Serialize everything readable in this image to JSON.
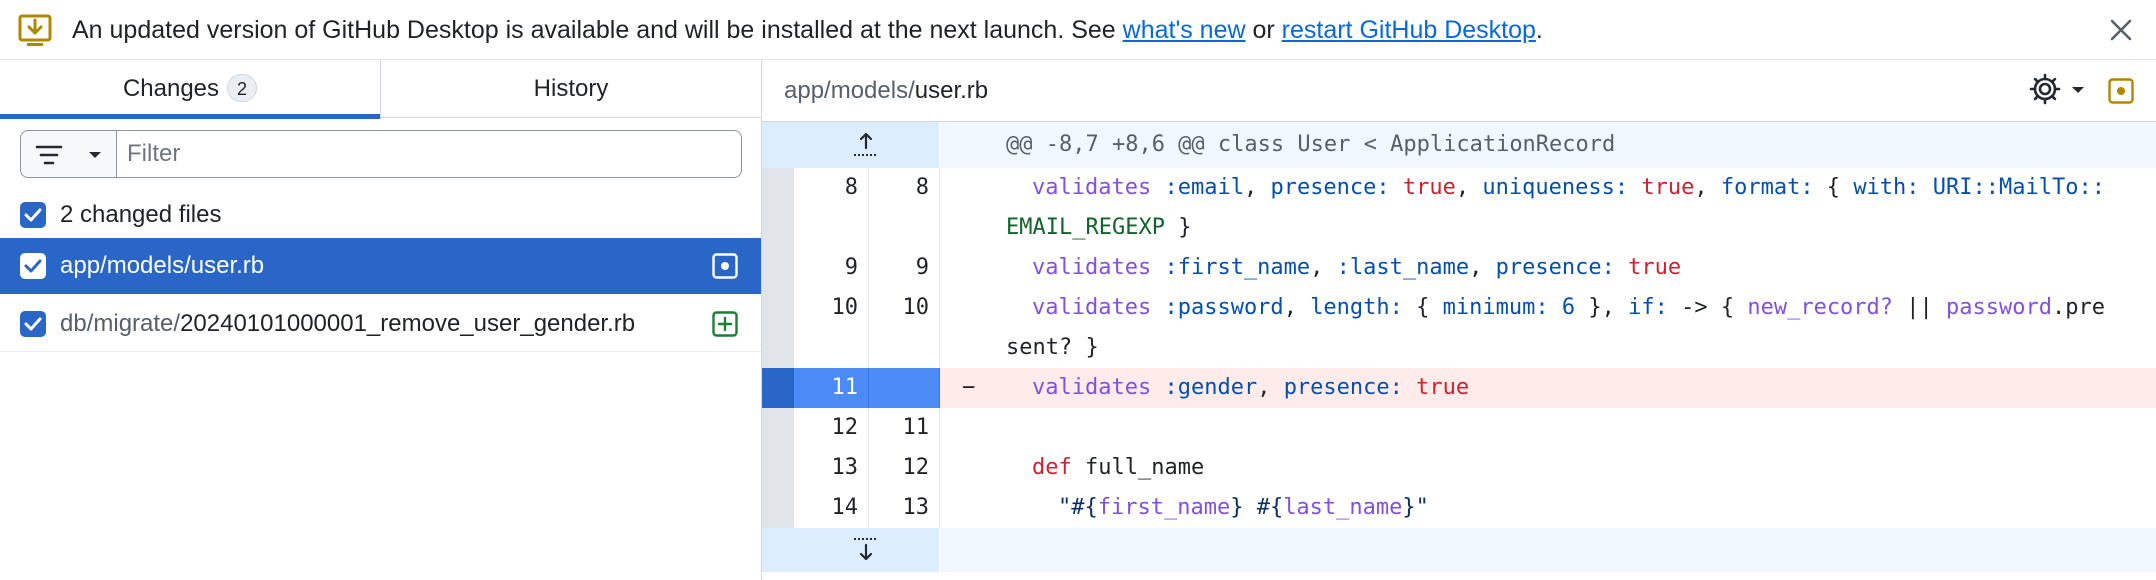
{
  "banner": {
    "message_prefix": "An updated version of GitHub Desktop is available and will be installed at the next launch. See ",
    "link_whats_new": "what's new",
    "message_mid": " or ",
    "link_restart": "restart GitHub Desktop",
    "message_suffix": "."
  },
  "sidebar": {
    "tabs": [
      {
        "label": "Changes",
        "count": "2"
      },
      {
        "label": "History"
      }
    ],
    "filter_placeholder": "Filter",
    "changed_files_label": "2 changed files",
    "files": [
      {
        "dir": "app/models/",
        "name": "user.rb",
        "status": "modified"
      },
      {
        "dir": "db/migrate/",
        "name": "20240101000001_remove_user_gender.rb",
        "status": "added"
      }
    ]
  },
  "diff": {
    "path_dir": "app/models/",
    "path_name": "user.rb",
    "hunk_header": "@@ -8,7 +8,6 @@ class User < ApplicationRecord",
    "lines": [
      {
        "old": "8",
        "new": "8"
      },
      {
        "old": "9",
        "new": "9"
      },
      {
        "old": "10",
        "new": "10"
      },
      {
        "old": "11",
        "new": "",
        "marker": "−"
      },
      {
        "old": "12",
        "new": "11"
      },
      {
        "old": "13",
        "new": "12"
      },
      {
        "old": "14",
        "new": "13"
      }
    ],
    "tokens": {
      "validates": "validates",
      "email_sym": ":email",
      "presence_kw": "presence:",
      "true_kw": "true",
      "uniqueness_kw": "uniqueness:",
      "format_kw": "format:",
      "with_kw": "with:",
      "uri_const": "URI::MailTo::",
      "regexp_const": "EMAIL_REGEXP",
      "first_name_sym": ":first_name",
      "last_name_sym": ":last_name",
      "password_sym": ":password",
      "length_kw": "length:",
      "minimum_kw": "minimum:",
      "six": "6",
      "if_kw": "if:",
      "new_record": "new_record?",
      "password_var": "password",
      "pre": ".pre",
      "sent": "sent? }",
      "gender_sym": ":gender",
      "def_kw": "def",
      "full_name": "full_name",
      "first_name_var": "first_name",
      "last_name_var": "last_name"
    }
  },
  "colors": {
    "accent": "#2a66c8",
    "banner_icon": "#b08800",
    "added": "#1a7f37",
    "deleted_bg": "#ffebe9"
  }
}
